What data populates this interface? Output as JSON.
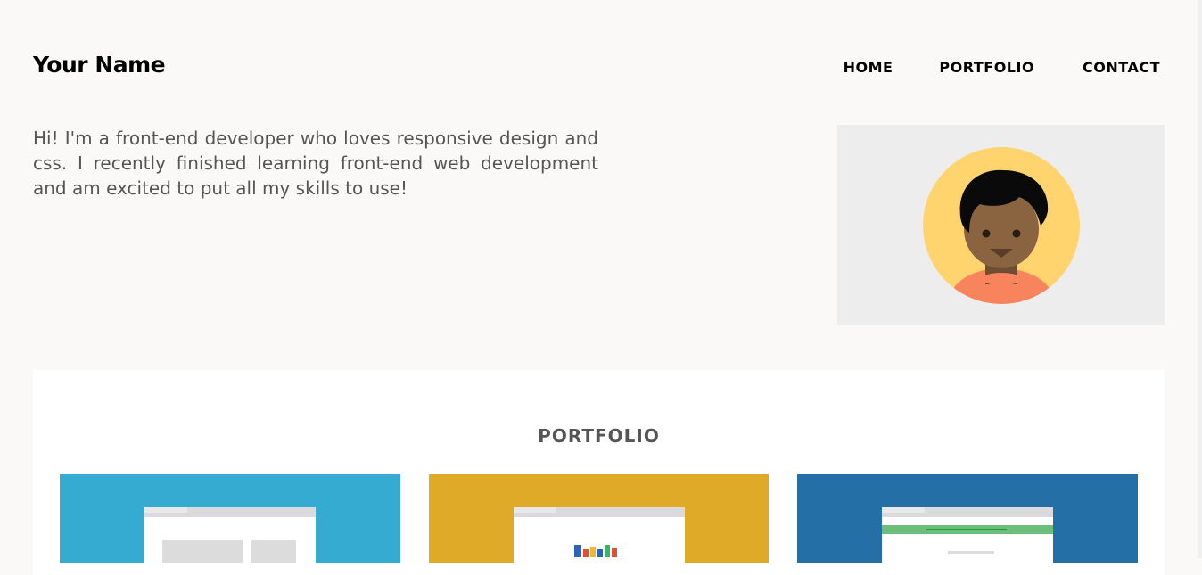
{
  "header": {
    "brand": "Your Name",
    "nav": [
      "HOME",
      "PORTFOLIO",
      "CONTACT"
    ]
  },
  "intro": {
    "text": "Hi! I'm a front-end developer who loves responsive design and css. I recently finished learning front-end web development and am excited to put all my skills to use!"
  },
  "portfolio": {
    "title": "PORTFOLIO",
    "cards": [
      {
        "color": "#36abd1"
      },
      {
        "color": "#e0aa29"
      },
      {
        "color": "#2470a6"
      }
    ]
  },
  "colors": {
    "background": "#faf9f7",
    "avatar_bg": "#ededed",
    "avatar_circle": "#ffd36e",
    "skin": "#8a6341",
    "shirt": "#f7845c"
  }
}
